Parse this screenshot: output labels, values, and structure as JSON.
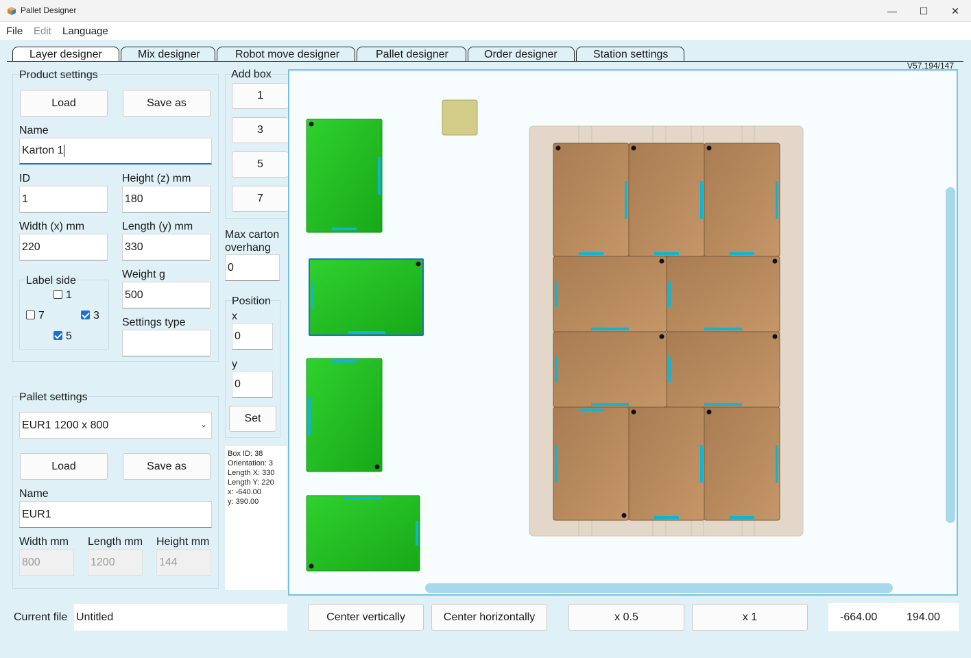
{
  "window": {
    "title": "Pallet Designer"
  },
  "menu": {
    "file": "File",
    "edit": "Edit",
    "language": "Language"
  },
  "tabs": [
    "Layer designer",
    "Mix designer",
    "Robot move designer",
    "Pallet designer",
    "Order designer",
    "Station settings"
  ],
  "version": "V57.194/147",
  "product": {
    "title": "Product settings",
    "load": "Load",
    "save_as": "Save as",
    "name_label": "Name",
    "name_value": "Karton 1",
    "id_label": "ID",
    "id_value": "1",
    "height_label": "Height (z) mm",
    "height_value": "180",
    "width_label": "Width (x) mm",
    "width_value": "220",
    "length_label": "Length (y) mm",
    "length_value": "330",
    "weight_label": "Weight g",
    "weight_value": "500",
    "settings_type_label": "Settings type",
    "settings_type_value": ""
  },
  "label_side": {
    "title": "Label side",
    "options": [
      {
        "label": "1",
        "checked": false
      },
      {
        "label": "7",
        "checked": false
      },
      {
        "label": "3",
        "checked": true
      },
      {
        "label": "5",
        "checked": true
      }
    ]
  },
  "pallet": {
    "title": "Pallet settings",
    "selected": "EUR1 1200 x 800",
    "load": "Load",
    "save_as": "Save as",
    "name_label": "Name",
    "name_value": "EUR1",
    "width_label": "Width mm",
    "width_value": "800",
    "length_label": "Length mm",
    "length_value": "1200",
    "height_label": "Height mm",
    "height_value": "144"
  },
  "add_box": {
    "title": "Add box",
    "buttons": [
      "1",
      "3",
      "5",
      "7"
    ]
  },
  "overhang": {
    "label": "Max carton overhang",
    "value": "0"
  },
  "position": {
    "title": "Position",
    "x_label": "x",
    "x_value": "0",
    "y_label": "y",
    "y_value": "0",
    "set": "Set"
  },
  "box_info": [
    "Box ID: 38",
    "Orientation: 3",
    "Length X: 330",
    "Length Y: 220",
    "x: -640.00",
    "y: 390.00"
  ],
  "footer": {
    "current_file_label": "Current file",
    "current_file_value": "Untitled",
    "center_vertically": "Center vertically",
    "center_horizontally": "Center horizontally",
    "zoom_half": "x 0.5",
    "zoom_one": "x 1",
    "coord_x": "-664.00",
    "coord_y": "194.00"
  },
  "colors": {
    "carton": "#b88a5b",
    "carton_border": "#7a5a38",
    "green_box": "#22bb22",
    "label_stripe": "#12b4cf",
    "pallet": "#e3d7c9",
    "selected_block": "#d2ce8a"
  }
}
